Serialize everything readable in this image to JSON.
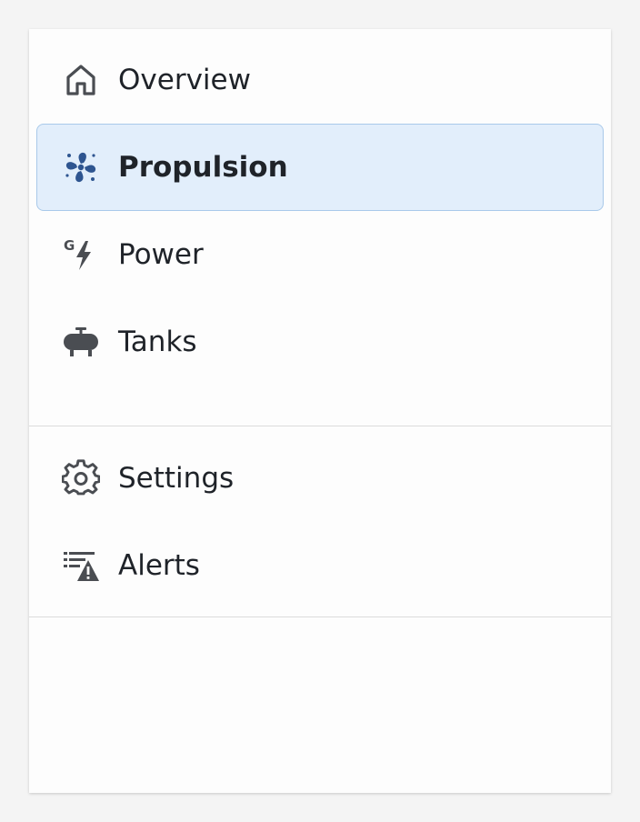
{
  "nav": {
    "primary": [
      {
        "id": "overview",
        "label": "Overview",
        "icon": "home-icon",
        "active": false
      },
      {
        "id": "propulsion",
        "label": "Propulsion",
        "icon": "fan-icon",
        "active": true
      },
      {
        "id": "power",
        "label": "Power",
        "icon": "generator-bolt-icon",
        "active": false
      },
      {
        "id": "tanks",
        "label": "Tanks",
        "icon": "tank-icon",
        "active": false
      }
    ],
    "secondary": [
      {
        "id": "settings",
        "label": "Settings",
        "icon": "gear-icon",
        "active": false
      },
      {
        "id": "alerts",
        "label": "Alerts",
        "icon": "alert-list-icon",
        "active": false
      }
    ],
    "power_icon_letter": "G"
  },
  "colors": {
    "active_background": "#e2eefb",
    "active_border": "#a9c9ea",
    "active_icon": "#2e5590",
    "icon": "#4a4d52",
    "text": "#1f2329",
    "divider": "#dcdcdc"
  }
}
